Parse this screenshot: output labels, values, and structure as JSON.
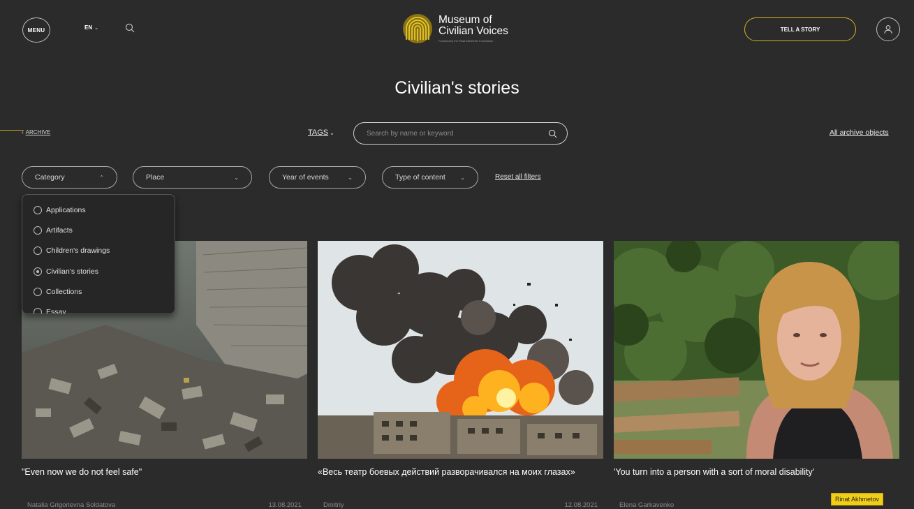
{
  "header": {
    "menu_label": "MENU",
    "language": "EN",
    "logo_line1": "Museum of",
    "logo_line2": "Civilian Voices",
    "logo_tagline": "Founded by the Rinat Akhmetov Foundation",
    "tell_story_label": "TELL A STORY",
    "icons": [
      "search-icon",
      "user-icon",
      "chevron-down-icon"
    ]
  },
  "page_title": "Civilian's stories",
  "breadcrumb": {
    "prefix": "‹",
    "label": "ARCHIVE"
  },
  "tags_label": "TAGS",
  "search": {
    "placeholder": "Search by name or keyword"
  },
  "all_archive_label": "All archive objects",
  "filters": [
    {
      "label": "Category",
      "chevron": "⌃"
    },
    {
      "label": "Place",
      "chevron": "⌄"
    },
    {
      "label": "Year of events",
      "chevron": "⌄"
    },
    {
      "label": "Type of content",
      "chevron": "⌄"
    }
  ],
  "reset_label": "Reset all filters",
  "category_options": [
    {
      "label": "Applications",
      "selected": false
    },
    {
      "label": "Artifacts",
      "selected": false
    },
    {
      "label": "Children's drawings",
      "selected": false
    },
    {
      "label": "Civilian's stories",
      "selected": true
    },
    {
      "label": "Collections",
      "selected": false
    },
    {
      "label": "Essay",
      "selected": false
    }
  ],
  "cards": [
    {
      "title": "\"Even now we do not feel safe\"",
      "author": "Natalia Grigorievna Soldatova",
      "date": "13.08.2021"
    },
    {
      "title": "«Весь театр боевых действий разворачивался на моих глазах»",
      "author": "Dmitriy",
      "date": "12.08.2021"
    },
    {
      "title": "'You turn into a person with a sort of moral disability'",
      "author": "Elena Garkavenko",
      "date": ""
    }
  ],
  "caption_badge": "Rinat Akhmetov",
  "colors": {
    "background": "#2b2b2b",
    "accent": "#d9b11e"
  }
}
